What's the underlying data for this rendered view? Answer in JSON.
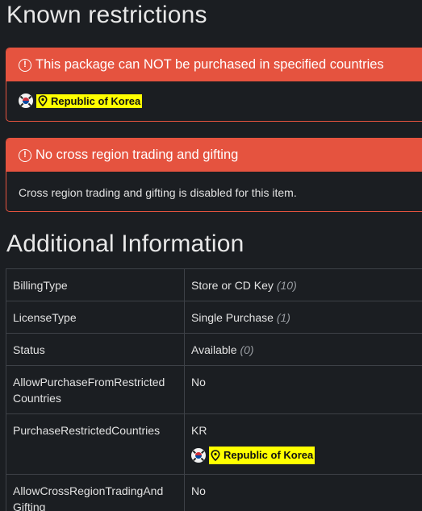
{
  "sections": {
    "restrictions_title": "Known restrictions",
    "additional_title": "Additional Information"
  },
  "restrictions": [
    {
      "title": "This package can NOT be purchased in specified countries",
      "country": "Republic of Korea"
    },
    {
      "title": "No cross region trading and gifting",
      "body": "Cross region trading and gifting is disabled for this item."
    }
  ],
  "info_rows": [
    {
      "key": "BillingType",
      "value": "Store or CD Key",
      "count": "(10)"
    },
    {
      "key": "LicenseType",
      "value": "Single Purchase",
      "count": "(1)"
    },
    {
      "key": "Status",
      "value": "Available",
      "count": "(0)"
    },
    {
      "key": "AllowPurchaseFromRestricted Countries",
      "value": "No"
    },
    {
      "key": "PurchaseRestrictedCountries",
      "value": "KR",
      "country": "Republic of Korea"
    },
    {
      "key": "AllowCrossRegionTradingAnd Gifting",
      "value": "No"
    }
  ],
  "colors": {
    "background": "#1b1e22",
    "alert": "#e5533f",
    "highlight": "#ffff00"
  },
  "icons": [
    "warning-circle-icon",
    "map-pin-icon",
    "korea-flag-icon"
  ]
}
